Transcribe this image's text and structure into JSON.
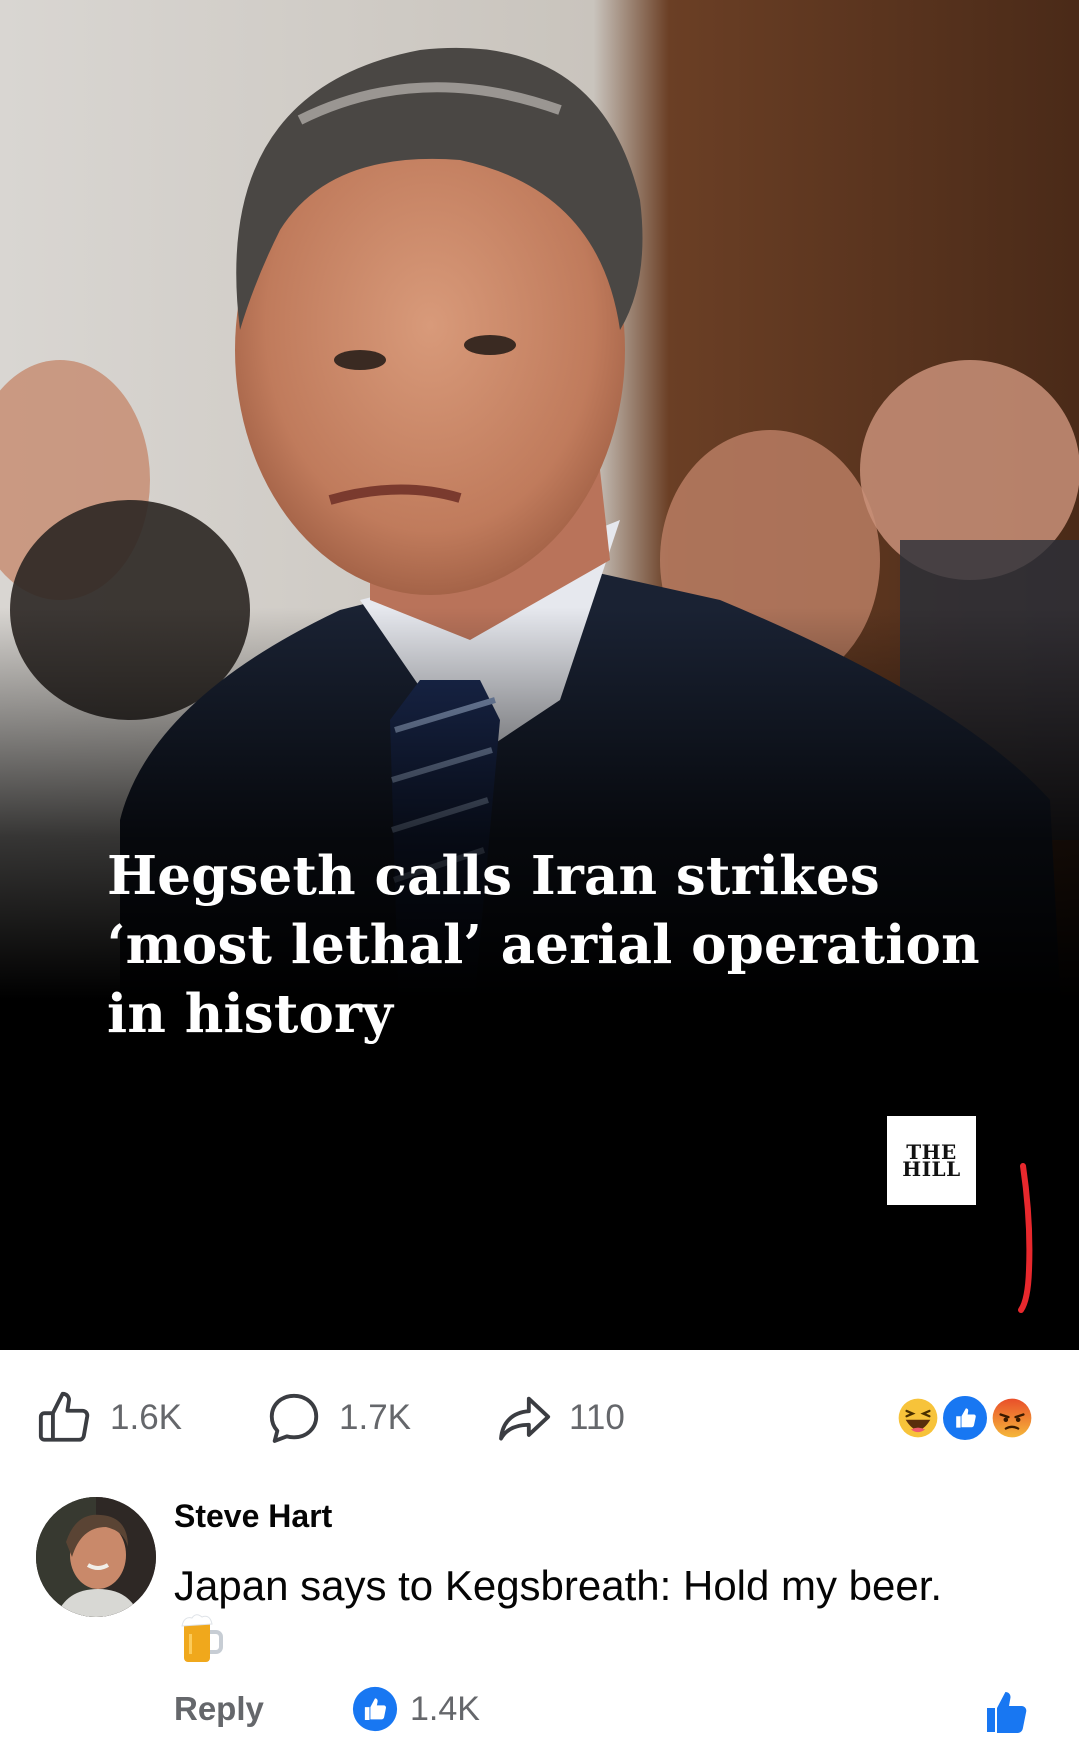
{
  "post": {
    "headline": "Hegseth calls Iran strikes ‘most lethal’ aerial operation in history",
    "source_logo_line1": "THE",
    "source_logo_line2": "HILL"
  },
  "actions": {
    "like_count": "1.6K",
    "comment_count": "1.7K",
    "share_count": "110",
    "reactions": [
      "haha-icon",
      "like-icon",
      "angry-icon"
    ]
  },
  "comment": {
    "author": "Steve Hart",
    "text": "Japan says to Kegsbreath: Hold my beer.",
    "emoji": "beer-mug-icon",
    "reply_label": "Reply",
    "like_count": "1.4K"
  },
  "colors": {
    "facebook_blue": "#1877f2",
    "muted_text": "#65676b",
    "annotation_red": "#e8282d"
  }
}
